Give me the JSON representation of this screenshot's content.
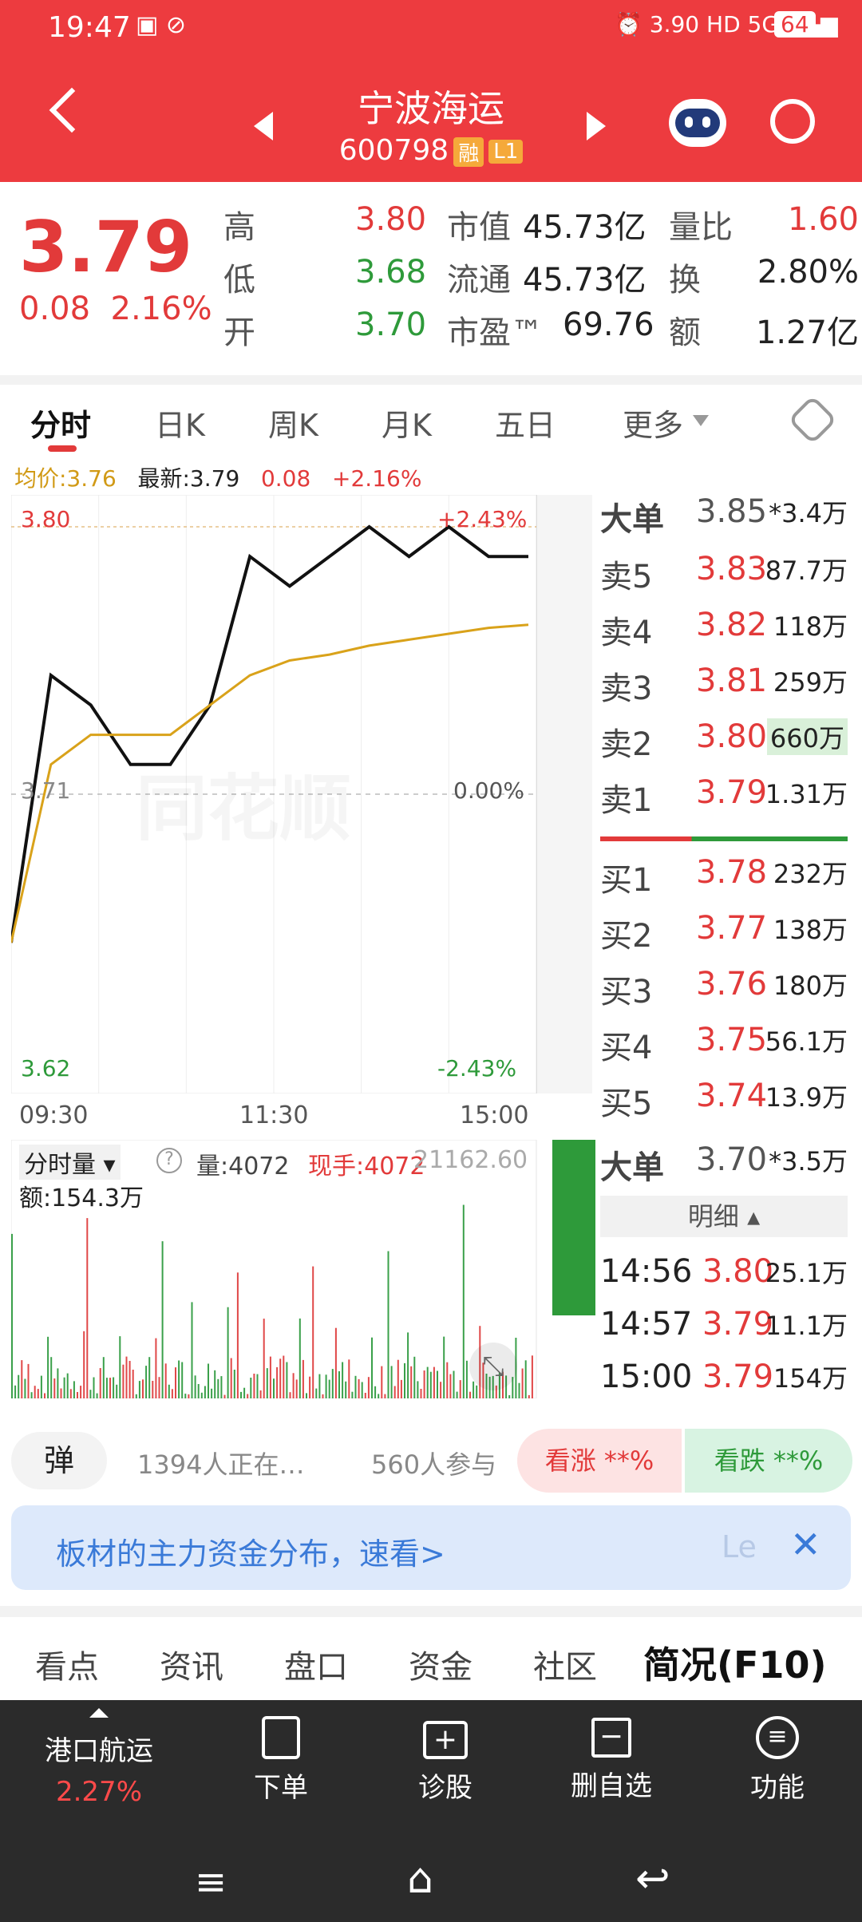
{
  "status_bar": {
    "time": "19:47",
    "speed": "3.90\nKB/s",
    "battery": "64"
  },
  "header": {
    "title": "宁波海运",
    "code": "600798",
    "badge_rong": "融",
    "badge_level": "L1"
  },
  "quote": {
    "price": "3.79",
    "change": "0.08",
    "change_pct": "2.16%",
    "high_label": "高",
    "high": "3.80",
    "low_label": "低",
    "low": "3.68",
    "open_label": "开",
    "open": "3.70",
    "mcap_label": "市值",
    "mcap": "45.73亿",
    "float_label": "流通",
    "float": "45.73亿",
    "pe_label": "市盈™",
    "pe": "69.76",
    "vr_label": "量比",
    "vr": "1.60",
    "turn_label": "换",
    "turn": "2.80%",
    "amt_label": "额",
    "amt": "1.27亿"
  },
  "tabs": [
    "分时",
    "日K",
    "周K",
    "月K",
    "五日",
    "更多"
  ],
  "chart_header": {
    "avg": "均价:3.76",
    "latest": "最新:3.79",
    "chg": "0.08",
    "pct": "+2.16%"
  },
  "chart_labels": {
    "high": "3.80",
    "high_pct": "+2.43%",
    "mid": "3.71",
    "mid_pct": "0.00%",
    "low": "3.62",
    "low_pct": "-2.43%",
    "t1": "09:30",
    "t2": "11:30",
    "t3": "15:00",
    "watermark": "同花顺"
  },
  "volume": {
    "mode": "分时量",
    "vol": "量:4072",
    "cur": "现手:4072",
    "max": "21162.60",
    "amt": "额:154.3万"
  },
  "orderbook": {
    "big_sell": {
      "label": "大单",
      "price": "3.85",
      "vol": "*3.4万"
    },
    "asks": [
      {
        "label": "卖5",
        "price": "3.83",
        "vol": "87.7万"
      },
      {
        "label": "卖4",
        "price": "3.82",
        "vol": "118万"
      },
      {
        "label": "卖3",
        "price": "3.81",
        "vol": "259万"
      },
      {
        "label": "卖2",
        "price": "3.80",
        "vol": "660万"
      },
      {
        "label": "卖1",
        "price": "3.79",
        "vol": "1.31万"
      }
    ],
    "bids": [
      {
        "label": "买1",
        "price": "3.78",
        "vol": "232万"
      },
      {
        "label": "买2",
        "price": "3.77",
        "vol": "138万"
      },
      {
        "label": "买3",
        "price": "3.76",
        "vol": "180万"
      },
      {
        "label": "买4",
        "price": "3.75",
        "vol": "56.1万"
      },
      {
        "label": "买5",
        "price": "3.74",
        "vol": "13.9万"
      }
    ],
    "big_buy": {
      "label": "大单",
      "price": "3.70",
      "vol": "*3.5万"
    },
    "detail_label": "明细",
    "ticks": [
      {
        "time": "14:56",
        "price": "3.80",
        "vol": "25.1万"
      },
      {
        "time": "14:57",
        "price": "3.79",
        "vol": "11.1万"
      },
      {
        "time": "15:00",
        "price": "3.79",
        "vol": "154万"
      }
    ]
  },
  "social": {
    "danmu": "弹",
    "watching": "1394人正在…",
    "participants": "560人参与",
    "bull": "看涨 **%",
    "bear": "看跌 **%"
  },
  "banner": {
    "text": "板材的主力资金分布，速看>",
    "suffix": "Le"
  },
  "bottom_tabs": [
    "看点",
    "资讯",
    "盘口",
    "资金",
    "社区",
    "简况(F10)"
  ],
  "toolbar": {
    "sector": "港口航运",
    "sector_pct": "2.27%",
    "order": "下单",
    "diagnose": "诊股",
    "remove": "删自选",
    "func": "功能"
  },
  "chart_data": {
    "type": "line",
    "x": [
      "09:30",
      "11:30",
      "15:00"
    ],
    "series": [
      {
        "values": [
          3.66,
          3.75,
          3.74,
          3.72,
          3.72,
          3.74,
          3.79,
          3.78,
          3.79,
          3.8,
          3.79,
          3.8,
          3.79,
          3.79
        ]
      },
      {
        "values": [
          3.66,
          3.72,
          3.73,
          3.73,
          3.73,
          3.74,
          3.75,
          3.755,
          3.757,
          3.76,
          3.762,
          3.764,
          3.766,
          3.767
        ]
      }
    ],
    "ylim": [
      3.62,
      3.8
    ]
  }
}
